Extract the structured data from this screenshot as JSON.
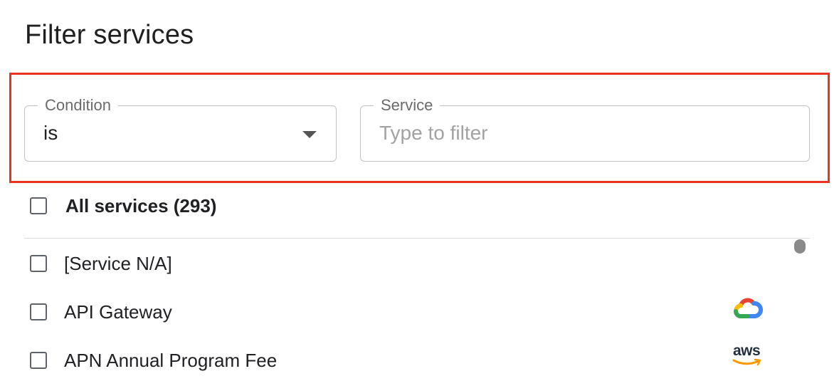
{
  "dialog": {
    "title": "Filter services"
  },
  "filters": {
    "condition": {
      "label": "Condition",
      "value": "is"
    },
    "service": {
      "label": "Service",
      "placeholder": "Type to filter"
    }
  },
  "all_services": {
    "label": "All services (293)",
    "checked": false
  },
  "services": [
    {
      "label": "[Service N/A]",
      "icon": "",
      "checked": false
    },
    {
      "label": "API Gateway",
      "icon": "google-cloud-icon",
      "checked": false
    },
    {
      "label": "APN Annual Program Fee",
      "icon": "aws-icon",
      "checked": false
    }
  ],
  "icons": {
    "aws_text": "aws"
  },
  "colors": {
    "highlight": "#ea3323",
    "gc_red": "#ea4335",
    "gc_blue": "#4285f4",
    "gc_yellow": "#fbbc04",
    "gc_green": "#34a853",
    "aws_orange": "#ff9900"
  }
}
